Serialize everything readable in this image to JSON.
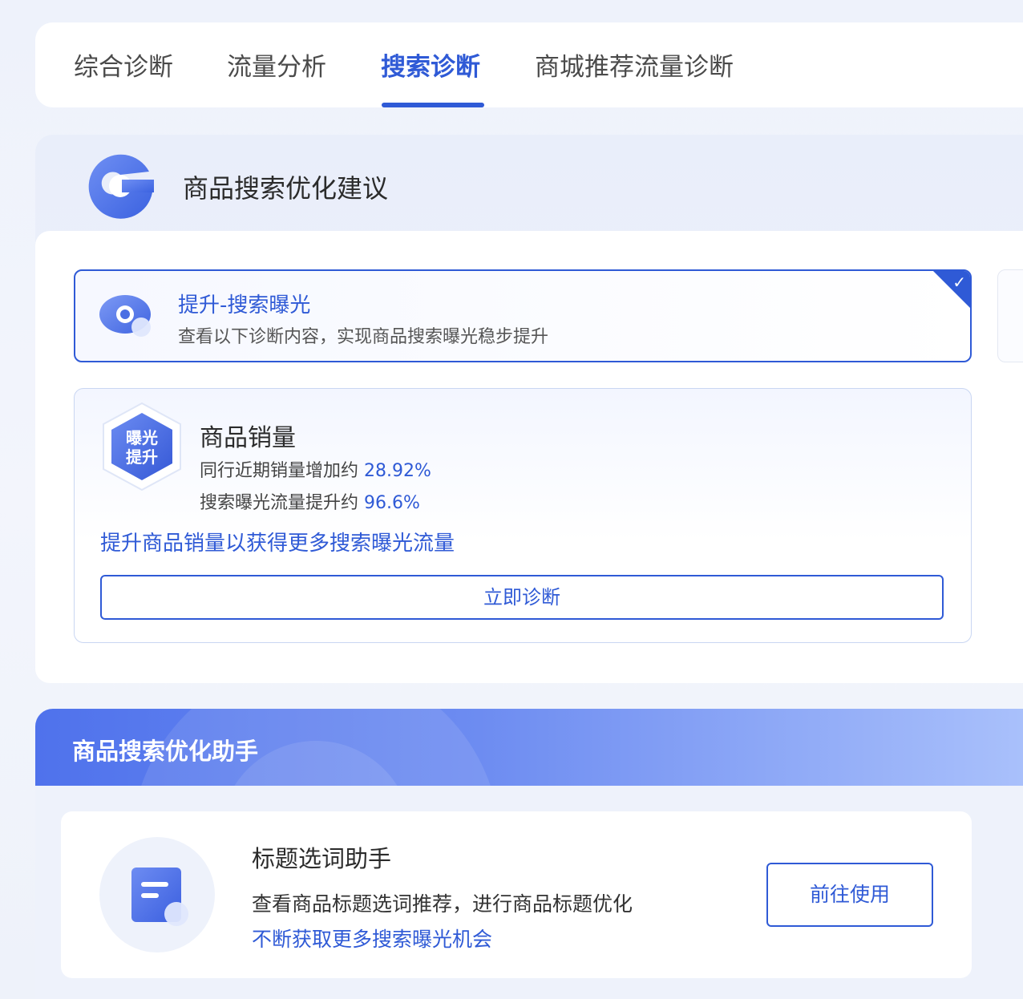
{
  "tabs": [
    {
      "label": "综合诊断",
      "active": false
    },
    {
      "label": "流量分析",
      "active": false
    },
    {
      "label": "搜索诊断",
      "active": true
    },
    {
      "label": "商城推荐流量诊断",
      "active": false
    }
  ],
  "advice": {
    "title": "商品搜索优化建议",
    "option": {
      "title": "提升-搜索曝光",
      "desc": "查看以下诊断内容，实现商品搜索曝光稳步提升",
      "selected": true
    },
    "sales": {
      "badge_line1": "曝光",
      "badge_line2": "提升",
      "title": "商品销量",
      "line1_label": "同行近期销量增加约 ",
      "line1_value": "28.92%",
      "line2_label": "搜索曝光流量提升约 ",
      "line2_value": "96.6%",
      "tip": "提升商品销量以获得更多搜索曝光流量",
      "button": "立即诊断"
    }
  },
  "helper": {
    "title": "商品搜索优化助手",
    "tool": {
      "title": "标题选词助手",
      "desc": "查看商品标题选词推荐，进行商品标题优化",
      "desc2": "不断获取更多搜索曝光机会",
      "button": "前往使用"
    }
  },
  "colors": {
    "accent": "#2f5ad6",
    "banner_start": "#4f72ec",
    "banner_end": "#a9c0fb"
  }
}
